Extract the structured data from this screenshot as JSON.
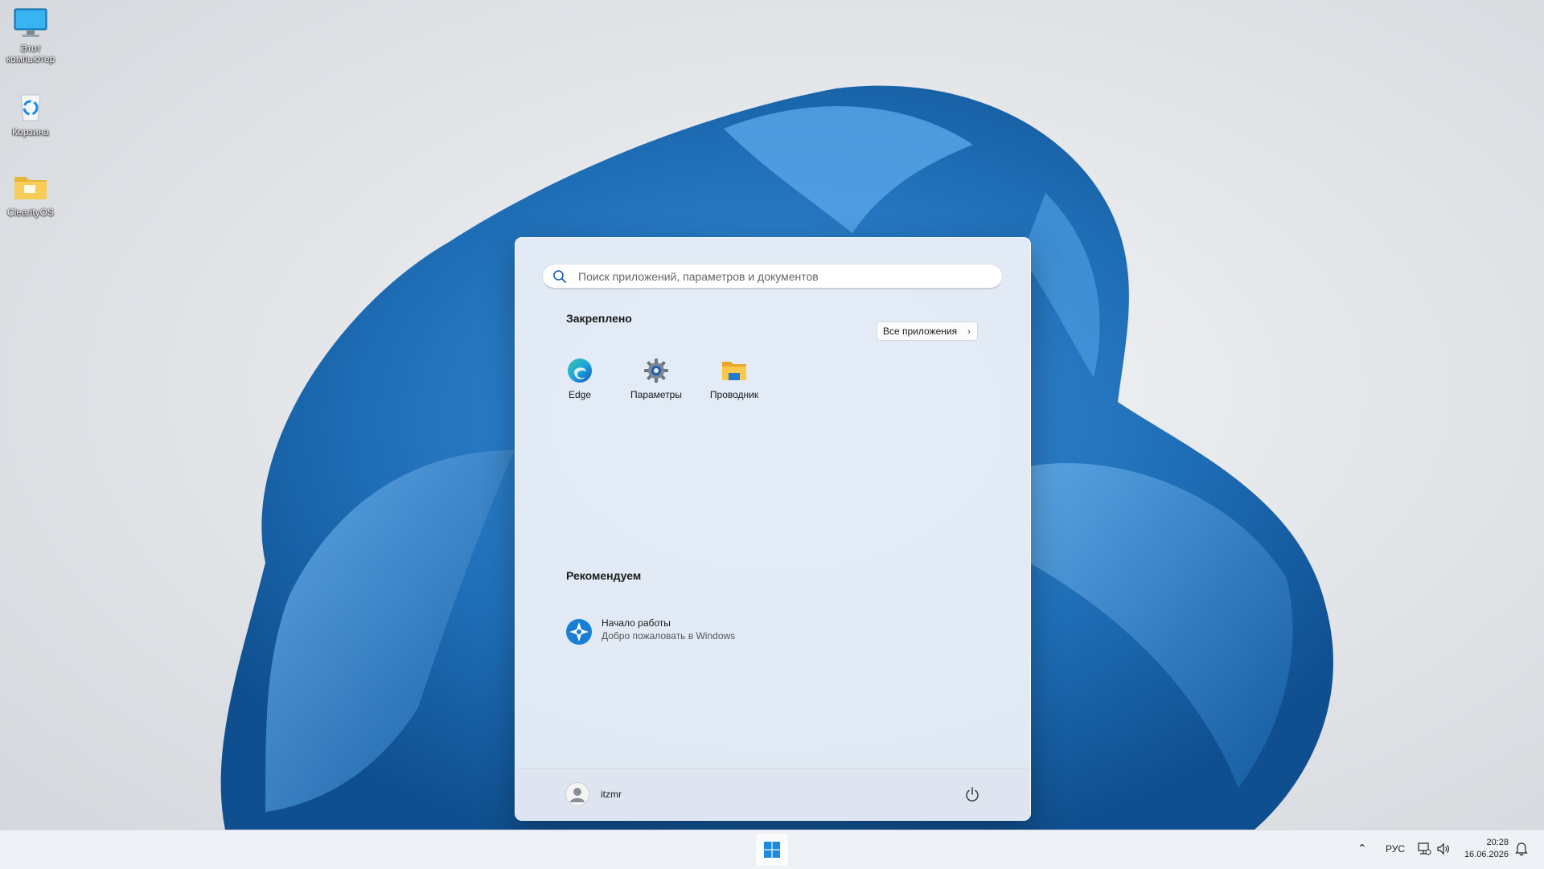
{
  "desktop": {
    "icons": [
      {
        "label": "Этот компьютер",
        "icon": "monitor-icon"
      },
      {
        "label": "Корзина",
        "icon": "recycle-bin-icon"
      },
      {
        "label": "ClearityOS",
        "icon": "folder-icon"
      }
    ]
  },
  "start_menu": {
    "search_placeholder": "Поиск приложений, параметров и документов",
    "pinned_title": "Закреплено",
    "all_apps_label": "Все приложения",
    "pinned": [
      {
        "label": "Edge",
        "icon": "edge-icon"
      },
      {
        "label": "Параметры",
        "icon": "settings-gear-icon"
      },
      {
        "label": "Проводник",
        "icon": "file-explorer-icon"
      }
    ],
    "recommended_title": "Рекомендуем",
    "recommended": [
      {
        "title": "Начало работы",
        "subtitle": "Добро пожаловать в Windows",
        "icon": "get-started-icon"
      }
    ],
    "user_name": "itzmr"
  },
  "taskbar": {
    "language": "РУС",
    "time": "20:28",
    "date": "16.06.2026"
  },
  "colors": {
    "accent": "#0078d4",
    "wallpaper_flower": "#2f7fc8"
  }
}
